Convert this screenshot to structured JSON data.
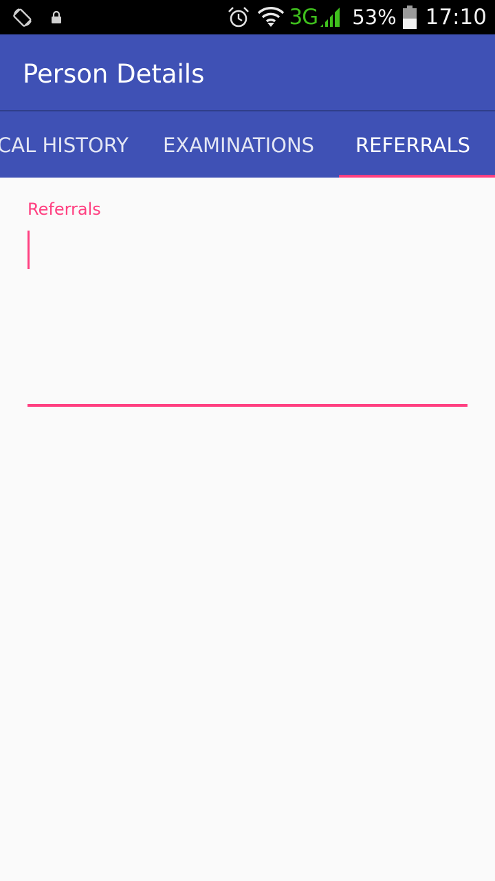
{
  "status_bar": {
    "icons_left": [
      "screen-rotation-icon",
      "lock-icon"
    ],
    "icons_right": [
      "alarm-icon",
      "wifi-icon",
      "signal-icon",
      "battery-icon"
    ],
    "network_type": "3G",
    "battery_percent": "53%",
    "time": "17:10"
  },
  "app_bar": {
    "title": "Person Details"
  },
  "tabs": {
    "items": [
      {
        "label": "CAL HISTORY"
      },
      {
        "label": "EXAMINATIONS"
      },
      {
        "label": "REFERRALS"
      }
    ],
    "selected": "REFERRALS"
  },
  "referrals_field": {
    "label": "Referrals",
    "value": ""
  },
  "colors": {
    "primary": "#3f51b5",
    "accent": "#ff4081",
    "status_bar": "#000000",
    "network": "#3fbf1d",
    "background": "#fafafa"
  }
}
